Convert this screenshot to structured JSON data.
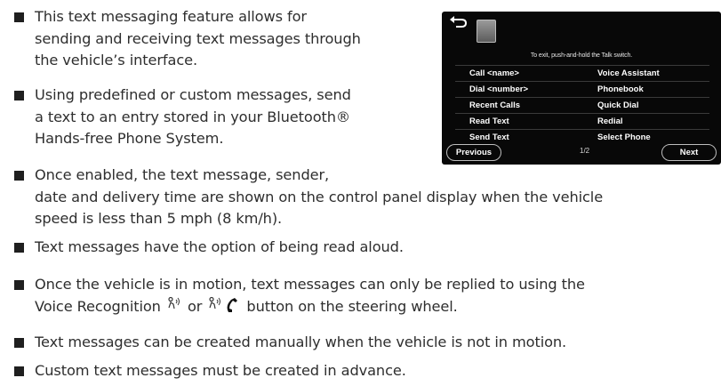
{
  "screen": {
    "hint": "To exit, push-and-hold the Talk switch.",
    "menu": [
      [
        "Call <name>",
        "Voice Assistant"
      ],
      [
        "Dial <number>",
        "Phonebook"
      ],
      [
        "Recent Calls",
        "Quick Dial"
      ],
      [
        "Read Text",
        "Redial"
      ],
      [
        "Send Text",
        "Select Phone"
      ]
    ],
    "previous_label": "Previous",
    "page_indicator": "1/2",
    "next_label": "Next"
  },
  "bullets": {
    "b1": {
      "l1": "This text messaging feature allows for",
      "l2": "sending and receiving text messages through",
      "l3": "the vehicle’s interface."
    },
    "b2": {
      "l1": "Using predefined or custom messages, send",
      "l2": "a text to an entry stored in your Bluetooth®",
      "l3": "Hands-free Phone System."
    },
    "b3": {
      "l1": "Once enabled, the text message, sender,",
      "l2": "date and delivery time are shown on the control panel display when the vehicle",
      "l3": "speed is less than 5 mph (8 km/h)."
    },
    "b4": {
      "l1": "Text messages have the option of being read aloud."
    },
    "b5": {
      "l1": "Once the vehicle is in motion, text messages can only be replied to using the",
      "l2a": "Voice Recognition",
      "or": "or",
      "l2b": "button on the steering wheel."
    },
    "b6": {
      "l1": "Text messages can be created manually when the vehicle is not in motion."
    },
    "b7": {
      "l1": "Custom text messages must be created in advance."
    }
  },
  "icons": {
    "voice_recognition": "voice-recognition-icon",
    "phone": "phone-handset-icon",
    "back": "back-arrow-icon"
  }
}
